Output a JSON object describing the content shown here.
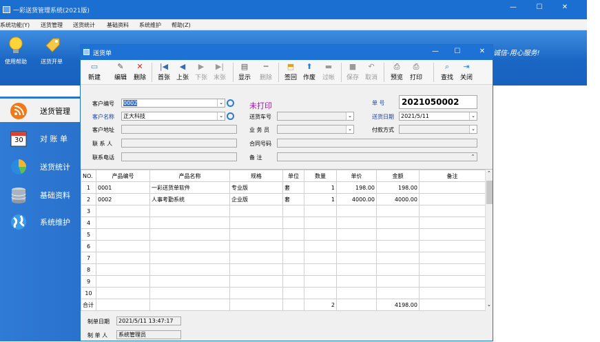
{
  "app": {
    "title": "一彩送货管理系统(2021版)",
    "window_controls": [
      "—",
      "☐",
      "✕"
    ]
  },
  "menu": [
    "系统功能(Y)",
    "送货管理",
    "送货统计",
    "基础资料",
    "系统维护",
    "帮助(Z)"
  ],
  "main_toolbar": {
    "buttons": [
      {
        "label": "使用帮助",
        "icon": "bulb-icon"
      },
      {
        "label": "送货开单",
        "icon": "tag-icon"
      }
    ],
    "slogan": "诚信-用心服务!"
  },
  "left_nav": [
    {
      "label": "送货管理",
      "icon": "rss-icon",
      "active": true
    },
    {
      "label": "对 账 单",
      "icon": "calendar-icon",
      "icon_text": "30"
    },
    {
      "label": "送货统计",
      "icon": "pie-icon"
    },
    {
      "label": "基础资料",
      "icon": "database-icon"
    },
    {
      "label": "系统维护",
      "icon": "globe-icon"
    }
  ],
  "dialog": {
    "title": "送货单",
    "controls": [
      "—",
      "☐",
      "✕"
    ],
    "toolbar": [
      {
        "label": "新建",
        "icon": "new-doc-icon",
        "disabled": false
      },
      {
        "label": "编辑",
        "icon": "edit-icon",
        "disabled": false
      },
      {
        "label": "删除",
        "icon": "delete-icon",
        "disabled": false
      },
      {
        "label": "首张",
        "icon": "first-icon",
        "disabled": false
      },
      {
        "label": "上张",
        "icon": "prev-icon",
        "disabled": false
      },
      {
        "label": "下张",
        "icon": "next-icon",
        "disabled": true
      },
      {
        "label": "末张",
        "icon": "last-icon",
        "disabled": true
      },
      {
        "label": "显示",
        "icon": "display-icon",
        "disabled": false
      },
      {
        "label": "删除",
        "icon": "remove-icon",
        "disabled": true
      },
      {
        "label": "签回",
        "icon": "signback-icon",
        "disabled": false
      },
      {
        "label": "作废",
        "icon": "void-icon",
        "disabled": false
      },
      {
        "label": "过帐",
        "icon": "post-icon",
        "disabled": true
      },
      {
        "label": "保存",
        "icon": "save-icon",
        "disabled": true
      },
      {
        "label": "取消",
        "icon": "cancel-icon",
        "disabled": true
      },
      {
        "label": "预览",
        "icon": "preview-icon",
        "disabled": false
      },
      {
        "label": "打印",
        "icon": "print-icon",
        "disabled": false
      },
      {
        "label": "查找",
        "icon": "search-icon",
        "disabled": false
      },
      {
        "label": "关闭",
        "icon": "close-door-icon",
        "disabled": false
      }
    ],
    "form": {
      "customer_code_label": "客户编号",
      "customer_code": "0002",
      "customer_name_label": "客户名称",
      "customer_name": "正大科技",
      "customer_address_label": "客户地址",
      "customer_address": "",
      "contact_label": "联 系 人",
      "contact": "",
      "contact_phone_label": "联系电话",
      "contact_phone": "",
      "print_status": "未打印",
      "vehicle_label": "送货车号",
      "vehicle": "",
      "salesman_label": "业 务 员",
      "salesman": "",
      "contract_label": "合同号码",
      "contract": "",
      "remarks_label": "备  注",
      "remarks": "",
      "doc_no_label": "单  号",
      "doc_no": "2021050002",
      "date_label": "送货日期",
      "date": "2021/5/11",
      "payment_label": "付款方式",
      "payment": ""
    },
    "grid": {
      "headers": [
        "NO.",
        "产品编号",
        "产品名称",
        "规格",
        "单位",
        "数量",
        "单价",
        "金额",
        "备注"
      ],
      "rows": [
        [
          "1",
          "0001",
          "一彩送货单软件",
          "专业版",
          "套",
          "1",
          "198.00",
          "198.00",
          ""
        ],
        [
          "2",
          "0002",
          "人事考勤系统",
          "企业版",
          "套",
          "1",
          "4000.00",
          "4000.00",
          ""
        ],
        [
          "3",
          "",
          "",
          "",
          "",
          "",
          "",
          "",
          ""
        ],
        [
          "4",
          "",
          "",
          "",
          "",
          "",
          "",
          "",
          ""
        ],
        [
          "5",
          "",
          "",
          "",
          "",
          "",
          "",
          "",
          ""
        ],
        [
          "6",
          "",
          "",
          "",
          "",
          "",
          "",
          "",
          ""
        ],
        [
          "7",
          "",
          "",
          "",
          "",
          "",
          "",
          "",
          ""
        ],
        [
          "8",
          "",
          "",
          "",
          "",
          "",
          "",
          "",
          ""
        ],
        [
          "9",
          "",
          "",
          "",
          "",
          "",
          "",
          "",
          ""
        ],
        [
          "10",
          "",
          "",
          "",
          "",
          "",
          "",
          "",
          ""
        ]
      ],
      "total": {
        "label": "合计",
        "quantity": "2",
        "amount": "4198.00"
      }
    },
    "footer": {
      "created_label": "制单日期",
      "created": "2021/5/11 13:47:17",
      "creator_label": "制 单 人",
      "creator": "系统管理员"
    }
  },
  "colors": {
    "title_blue": "#1b6fd1",
    "nav_blue": "#2f7bd6",
    "status_magenta": "#c000c0"
  }
}
